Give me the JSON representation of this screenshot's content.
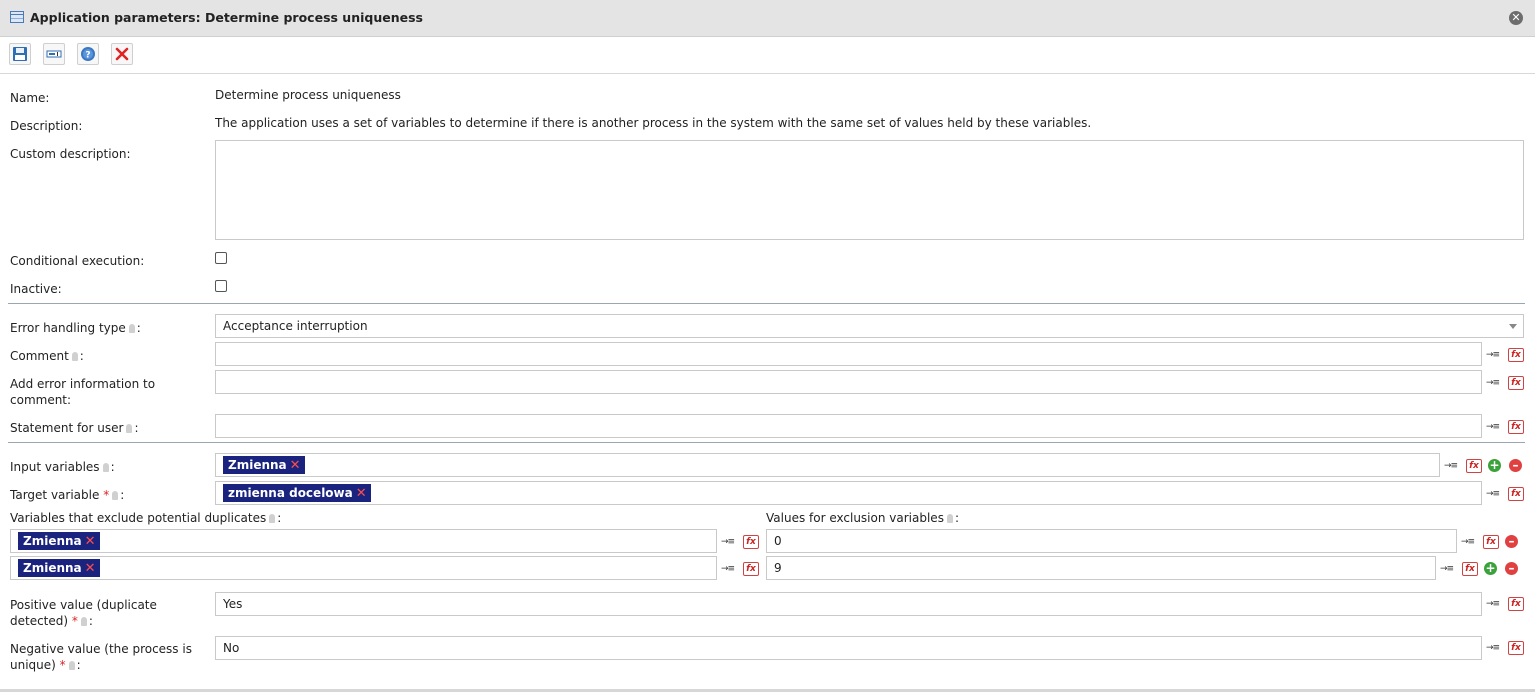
{
  "window": {
    "title": "Application parameters: Determine process uniqueness",
    "icon": "table-icon",
    "close_icon": "close-icon"
  },
  "toolbar": {
    "buttons": [
      "save-icon",
      "variables-icon",
      "help-icon",
      "cancel-icon"
    ]
  },
  "form": {
    "name_label": "Name:",
    "name_value": "Determine process uniqueness",
    "description_label": "Description:",
    "description_value": "The application uses a set of variables to determine if there is another process in the system with the same set of values held by these variables.",
    "custom_description_label": "Custom description:",
    "custom_description_value": "",
    "conditional_execution_label": "Conditional execution:",
    "conditional_execution_checked": false,
    "inactive_label": "Inactive:",
    "inactive_checked": false,
    "error_handling_label": "Error handling type",
    "error_handling_value": "Acceptance interruption",
    "comment_label": "Comment",
    "comment_value": "",
    "add_error_info_label_line1": "Add error information to",
    "add_error_info_label_line2": "comment:",
    "add_error_info_value": "",
    "statement_label": "Statement for user",
    "statement_value": "",
    "input_variables_label": "Input variables",
    "input_variables": [
      "Zmienna"
    ],
    "target_variable_label": "Target variable",
    "target_variable": "zmienna docelowa",
    "exclude_vars_label": "Variables that exclude potential duplicates",
    "exclude_values_label": "Values for exclusion variables",
    "exclusion_rows": [
      {
        "variable": "Zmienna",
        "value": "0"
      },
      {
        "variable": "Zmienna",
        "value": "9"
      }
    ],
    "positive_label_line1": "Positive value (duplicate",
    "positive_label_line2": "detected)",
    "positive_value": "Yes",
    "negative_label_line1": "Negative value (the process is",
    "negative_label_line2": "unique)",
    "negative_value": "No",
    "colon": ":",
    "required_mark": "*",
    "tag_remove": "✕"
  },
  "colors": {
    "tag_bg": "#1a237e",
    "required": "#e02020",
    "add": "#3aa23a",
    "remove": "#e04040"
  }
}
